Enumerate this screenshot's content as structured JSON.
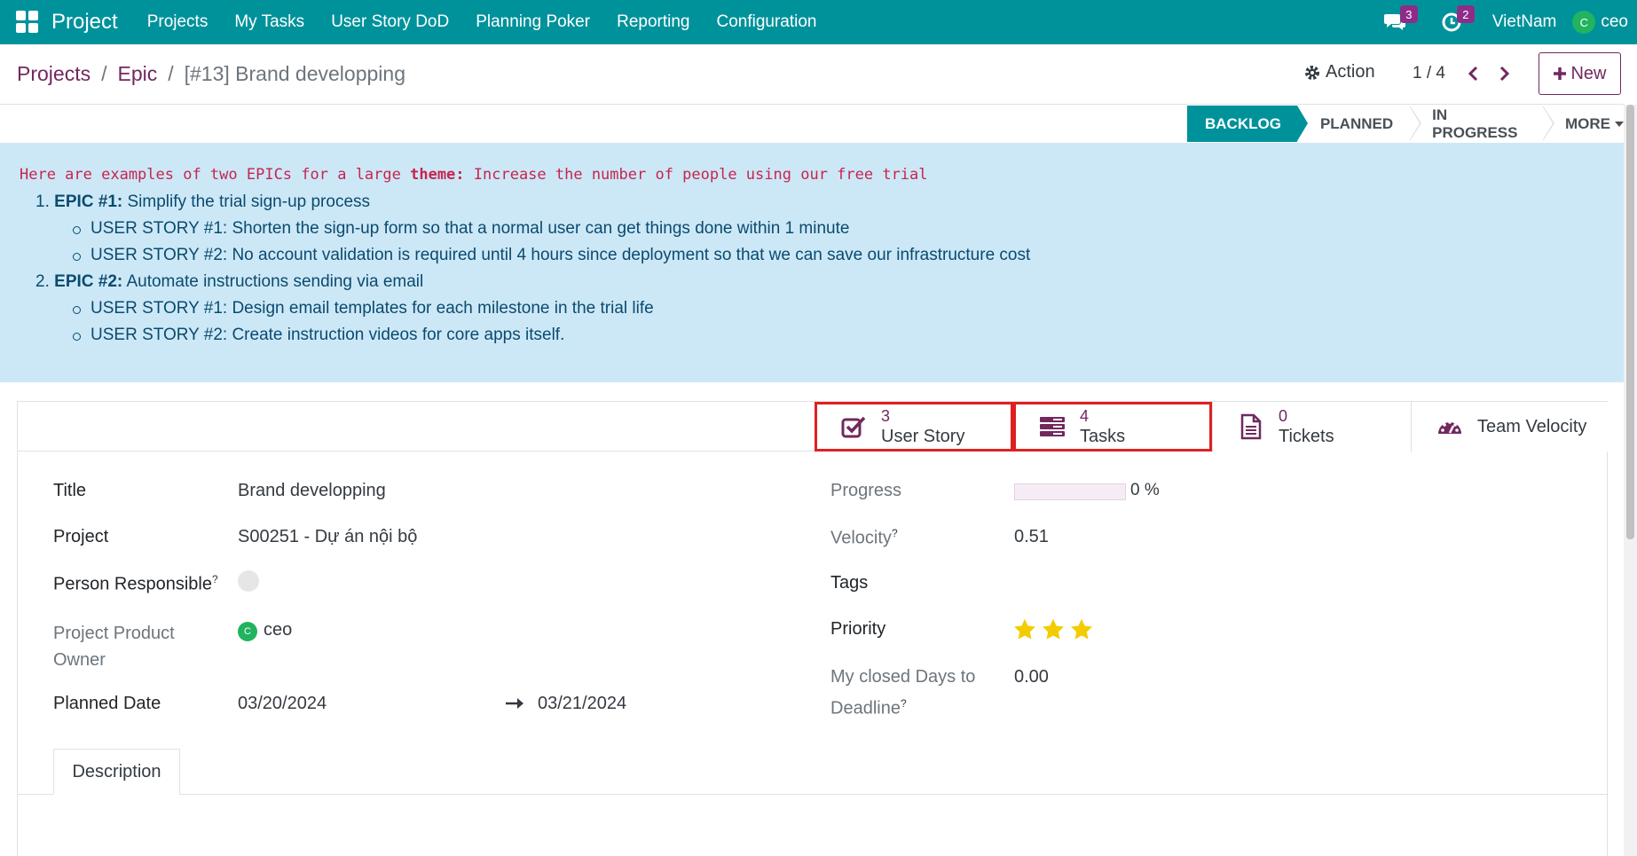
{
  "navbar": {
    "app_name": "Project",
    "menu": [
      "Projects",
      "My Tasks",
      "User Story DoD",
      "Planning Poker",
      "Reporting",
      "Configuration"
    ],
    "messages_badge": "3",
    "activities_badge": "2",
    "company": "VietNam",
    "user_initial": "C",
    "user_name": "ceo",
    "color": "#00929b"
  },
  "breadcrumb": {
    "items": [
      "Projects",
      "Epic"
    ],
    "current": "[#13] Brand developping"
  },
  "control": {
    "action_label": "Action",
    "pager": "1 / 4",
    "new_label": "New"
  },
  "statusbar": {
    "stages": [
      "BACKLOG",
      "PLANNED",
      "IN PROGRESS",
      "MORE"
    ],
    "active": "BACKLOG"
  },
  "alert": {
    "intro_prefix": "Here are examples of two EPICs for a large ",
    "intro_bold": "theme:",
    "intro_suffix": " Increase the number of people using our free trial",
    "epics": [
      {
        "num": "1.",
        "title": "EPIC #1:",
        "text": " Simplify the trial sign-up process",
        "stories": [
          "USER STORY #1: Shorten the sign-up form so that a normal user can get things done within 1 minute",
          "USER STORY #2: No account validation is required until 4 hours since deployment so that we can save our infrastructure cost"
        ]
      },
      {
        "num": "2.",
        "title": "EPIC #2:",
        "text": " Automate instructions sending via email",
        "stories": [
          "USER STORY #1: Design email templates for each milestone in the trial life",
          "USER STORY #2: Create instruction videos for core apps itself."
        ]
      }
    ]
  },
  "smart_buttons": [
    {
      "count": "3",
      "label": "User Story",
      "icon": "checkbox-icon"
    },
    {
      "count": "4",
      "label": "Tasks",
      "icon": "tasks-icon"
    },
    {
      "count": "0",
      "label": "Tickets",
      "icon": "document-icon"
    },
    {
      "label": "Team Velocity",
      "icon": "speedometer-icon"
    }
  ],
  "form": {
    "title_label": "Title",
    "title_value": "Brand developping",
    "project_label": "Project",
    "project_value": "S00251 - Dự án nội bộ",
    "responsible_label": "Person Responsible",
    "product_owner_label_1": "Project Product",
    "product_owner_label_2": "Owner",
    "product_owner_initial": "C",
    "product_owner_value": "ceo",
    "planned_label": "Planned Date",
    "planned_start": "03/20/2024",
    "planned_end": "03/21/2024",
    "progress_label": "Progress",
    "progress_value": "0 %",
    "progress_fraction": 0,
    "velocity_label": "Velocity",
    "velocity_value": "0.51",
    "tags_label": "Tags",
    "priority_label": "Priority",
    "priority_stars": 3,
    "closed_days_label_1": "My closed Days to",
    "closed_days_label_2": "Deadline",
    "closed_days_value": "0.00",
    "help_mark": "?"
  },
  "tabs": [
    "Description"
  ],
  "colors": {
    "brand_purple": "#71285f",
    "alert_bg": "#cce8f7",
    "highlight_red": "#e02020",
    "star_yellow": "#f3cc00"
  }
}
